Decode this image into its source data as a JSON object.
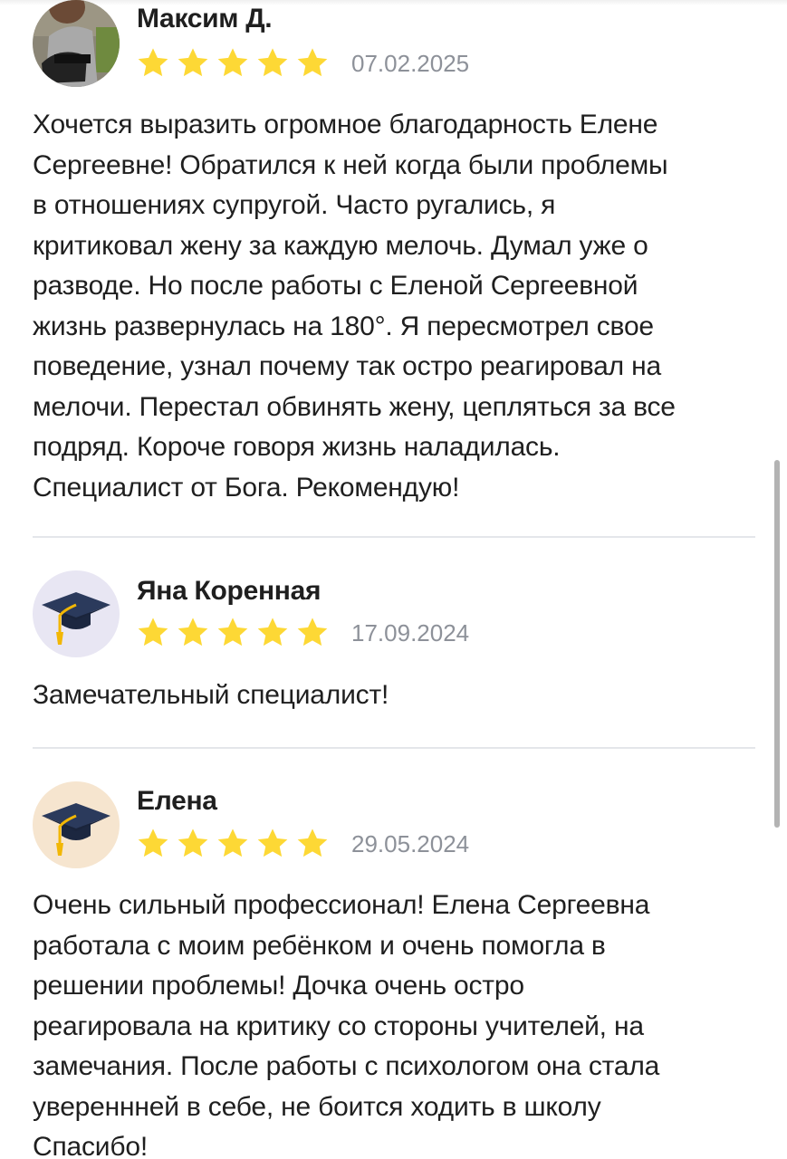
{
  "reviews": [
    {
      "author": "Максим Д.",
      "rating": 5,
      "date": "07.02.2025",
      "avatar": "user-photo",
      "text": "Хочется выразить огромное благодарность Елене\nСергеевне! Обратился к ней когда были проблемы\nв отношениях супругой. Часто ругались, я\nкритиковал жену за каждую мелочь. Думал уже о\nразводе. Но после работы с Еленой Сергеевной\nжизнь развернулась на 180°. Я пересмотрел свое\nповедение, узнал почему так остро реагировал на\nмелочи. Перестал обвинять жену, цепляться за все\nподряд. Короче говоря жизнь наладилась.\nСпециалист от Бога. Рекомендую!"
    },
    {
      "author": "Яна Коренная",
      "rating": 5,
      "date": "17.09.2024",
      "avatar": "graduation-cap-icon",
      "avatar_bg": "#e8e6f3",
      "text": "Замечательный специалист!"
    },
    {
      "author": "Елена",
      "rating": 5,
      "date": "29.05.2024",
      "avatar": "graduation-cap-icon",
      "avatar_bg": "#f6e5cf",
      "text": "Очень сильный профессионал! Елена Сергеевна\nработала с моим ребёнком и очень помогла в\nрешении проблемы! Дочка очень остро\nреагировала на критику со стороны учителей, на\nзамечания. После работы с психологом она стала\nувереннней в себе, не боится ходить в школу\nСпасибо!"
    }
  ],
  "colors": {
    "star": "#fdd835",
    "date": "#8d9199",
    "text": "#1f1f1f",
    "divider": "#e4e6ea"
  }
}
